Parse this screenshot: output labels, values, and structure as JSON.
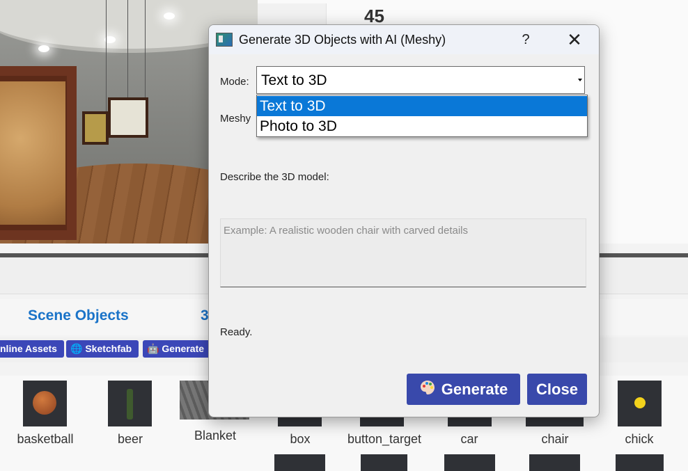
{
  "background": {
    "header_number": "45",
    "tabs": {
      "scene_objects": "Scene Objects",
      "partial": "3"
    },
    "asset_buttons": {
      "online_assets": "nline Assets",
      "sketchfab": "Sketchfab",
      "generate": "Generate"
    },
    "assets": [
      {
        "label": "basketball",
        "icon": "basketball-icon"
      },
      {
        "label": "beer",
        "icon": "bottle-icon"
      },
      {
        "label": "Blanket",
        "icon": "blanket-icon"
      },
      {
        "label": "box",
        "icon": "box-icon"
      },
      {
        "label": "button_target",
        "icon": "target-icon"
      },
      {
        "label": "car",
        "icon": "car-icon"
      },
      {
        "label": "chair",
        "icon": "chair-icon"
      },
      {
        "label": "chick",
        "icon": "chick-icon"
      }
    ]
  },
  "dialog": {
    "title": "Generate 3D Objects with AI (Meshy)",
    "help": "?",
    "close_glyph": "✕",
    "mode_label": "Mode:",
    "mode_value": "Text to 3D",
    "mode_options": [
      "Text to 3D",
      "Photo to 3D"
    ],
    "mode_selected_index": 0,
    "meshy_label": "Meshy",
    "describe_label": "Describe the 3D model:",
    "description_placeholder": "Example: A realistic wooden chair with carved details",
    "description_value": "",
    "status": "Ready.",
    "generate_button": "Generate",
    "close_button": "Close",
    "accent_color": "#3949ab",
    "selection_color": "#0a78d7"
  }
}
